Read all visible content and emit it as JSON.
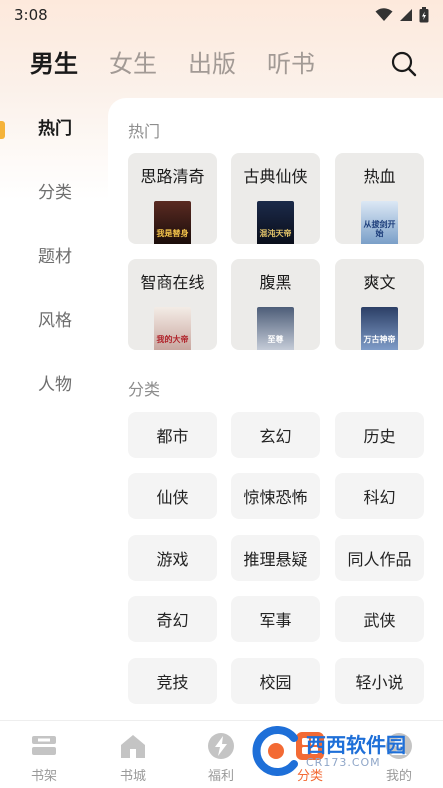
{
  "status_bar": {
    "time": "3:08"
  },
  "header": {
    "tabs": [
      {
        "label": "男生",
        "active": true
      },
      {
        "label": "女生",
        "active": false
      },
      {
        "label": "出版",
        "active": false
      },
      {
        "label": "听书",
        "active": false
      }
    ],
    "search_icon": "search-icon"
  },
  "sidebar": {
    "items": [
      {
        "label": "热门",
        "active": true
      },
      {
        "label": "分类",
        "active": false
      },
      {
        "label": "题材",
        "active": false
      },
      {
        "label": "风格",
        "active": false
      },
      {
        "label": "人物",
        "active": false
      }
    ],
    "indicator_color": "#f5b33a"
  },
  "hot": {
    "title": "热门",
    "themes": [
      {
        "label": "思路清奇",
        "cover_text": "我是替身"
      },
      {
        "label": "古典仙侠",
        "cover_text": "混沌天帝"
      },
      {
        "label": "热血",
        "cover_text": "从拔剑开始"
      },
      {
        "label": "智商在线",
        "cover_text": "我的大帝"
      },
      {
        "label": "腹黑",
        "cover_text": "至尊"
      },
      {
        "label": "爽文",
        "cover_text": "万古神帝"
      }
    ]
  },
  "categories": {
    "title": "分类",
    "items": [
      "都市",
      "玄幻",
      "历史",
      "仙侠",
      "惊悚恐怖",
      "科幻",
      "游戏",
      "推理悬疑",
      "同人作品",
      "奇幻",
      "军事",
      "武侠",
      "竞技",
      "校园",
      "轻小说"
    ]
  },
  "bottom_nav": {
    "items": [
      {
        "label": "书架",
        "icon": "bookshelf-icon",
        "active": false
      },
      {
        "label": "书城",
        "icon": "bookstore-icon",
        "active": false
      },
      {
        "label": "福利",
        "icon": "lightning-icon",
        "active": false
      },
      {
        "label": "分类",
        "icon": "category-grid-icon",
        "active": true
      },
      {
        "label": "我的",
        "icon": "profile-icon",
        "active": false
      }
    ]
  },
  "watermark": {
    "main": "西西软件园",
    "sub": "CR173.COM"
  },
  "colors": {
    "accent": "#f36a34",
    "sidebar_indicator": "#f5b33a",
    "card_bg": "#ecebe9",
    "category_bg": "#f4f4f4"
  }
}
